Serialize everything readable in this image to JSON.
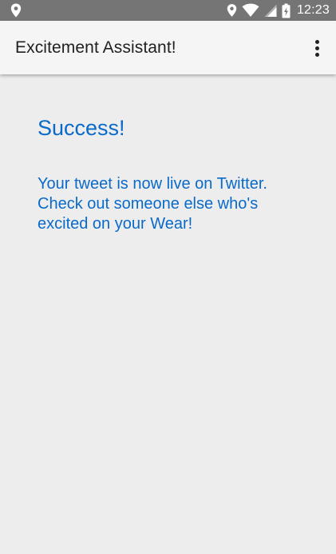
{
  "status_bar": {
    "left_icon": "location-pin-icon",
    "right_icons": [
      "location-pin-icon",
      "wifi-icon",
      "cellular-signal-icon",
      "battery-charging-icon"
    ],
    "time": "12:23"
  },
  "app_bar": {
    "title": "Excitement Assistant!",
    "overflow_icon": "more-vert-icon"
  },
  "content": {
    "heading": "Success!",
    "message_lines": [
      "Your tweet is now live on Twitter.",
      "Check out someone else who's",
      "excited on your Wear!"
    ]
  },
  "colors": {
    "status_bar_bg": "#757575",
    "app_bar_bg": "#f5f5f5",
    "content_bg": "#ededed",
    "accent_text": "#0a6ac9",
    "title_text": "#212121"
  }
}
